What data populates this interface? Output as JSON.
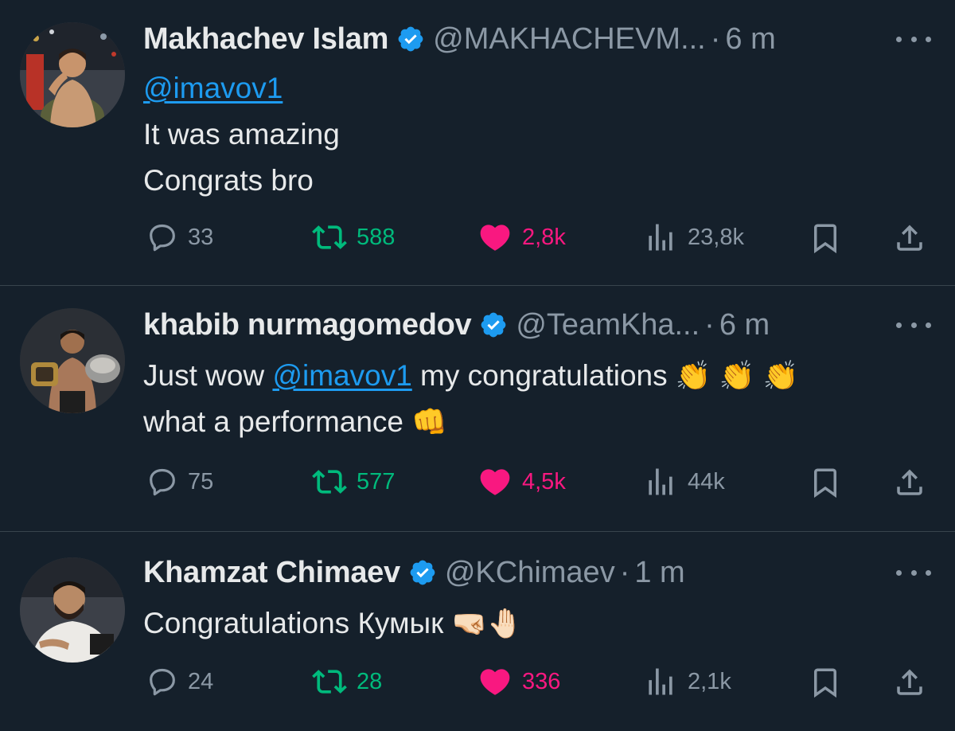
{
  "tweets": [
    {
      "name": "Makhachev Islam",
      "handle": "@MAKHACHEVM...",
      "dot": "·",
      "time": "6 m",
      "mention": "@imavov1",
      "lines": [
        "It was amazing",
        "Congrats bro"
      ],
      "replies": "33",
      "retweets": "588",
      "likes": "2,8k",
      "views": "23,8k"
    },
    {
      "name": "khabib nurmagomedov",
      "handle": "@TeamKha...",
      "dot": "·",
      "time": "6 m",
      "text_before": "Just wow ",
      "mention": "@imavov1",
      "text_after": " my congratulations ",
      "emoji_after": "👏 👏 👏",
      "line2": "what a performance ",
      "emoji_line2": "👊",
      "replies": "75",
      "retweets": "577",
      "likes": "4,5k",
      "views": "44k"
    },
    {
      "name": "Khamzat Chimaev",
      "handle": "@KChimaev",
      "dot": "·",
      "time": "1 m",
      "text": "Congratulations Кумык ",
      "emoji": "🤜🏻🤚🏻",
      "replies": "24",
      "retweets": "28",
      "likes": "336",
      "views": "2,1k"
    }
  ],
  "colors": {
    "background": "#15202b",
    "verified": "#1d9bf0",
    "retweet": "#00ba7c",
    "like": "#f91880",
    "muted": "#8b98a5"
  },
  "icons": [
    "reply-icon",
    "retweet-icon",
    "like-icon",
    "views-icon",
    "bookmark-icon",
    "share-icon",
    "verified-badge-icon",
    "more-icon"
  ]
}
